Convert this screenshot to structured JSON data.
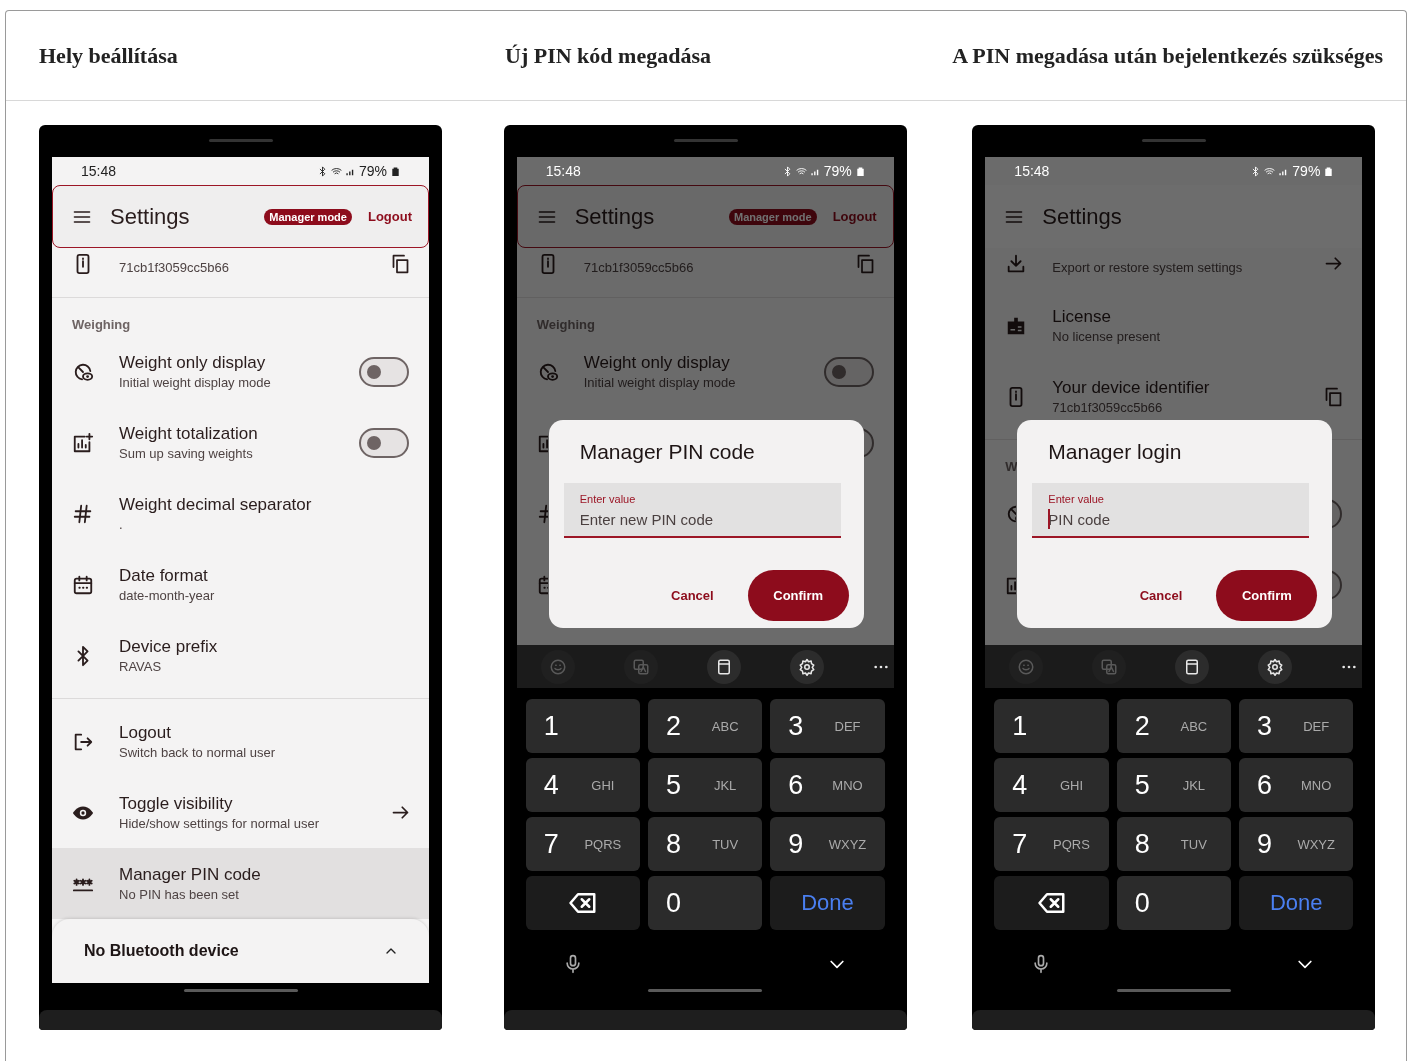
{
  "captions": [
    "Hely beállítása",
    "Új PIN kód megadása",
    "A PIN megadása után bejelentkezés szükséges"
  ],
  "phones": [
    {
      "status": {
        "time": "15:48",
        "battery": "79%"
      },
      "app_bar": {
        "title": "Settings",
        "badge": "Manager mode",
        "action": "Logout",
        "outlined": true
      },
      "list": [
        {
          "kind": "copy",
          "subtitle": "71cb1f3059cc5b66",
          "selected": false
        },
        {
          "kind": "divider"
        },
        {
          "kind": "header",
          "label": "Weighing"
        },
        {
          "kind": "toggle",
          "title": "Weight only display",
          "subtitle": "Initial weight display mode",
          "on": false,
          "selected": false
        },
        {
          "kind": "toggle",
          "title": "Weight totalization",
          "subtitle": "Sum up saving weights",
          "on": false,
          "selected": false
        },
        {
          "kind": "plain",
          "title": "Weight decimal separator",
          "subtitle": ".",
          "selected": false
        },
        {
          "kind": "plain",
          "title": "Date format",
          "subtitle": "date-month-year",
          "selected": false
        },
        {
          "kind": "plain",
          "title": "Device prefix",
          "subtitle": "RAVAS",
          "selected": false
        },
        {
          "kind": "divider"
        },
        {
          "kind": "plain",
          "title": "Logout",
          "subtitle": "Switch back to normal user",
          "selected": false
        },
        {
          "kind": "arrow",
          "title": "Toggle visibility",
          "subtitle": "Hide/show settings for normal user",
          "selected": false
        },
        {
          "kind": "plain",
          "title": "Manager PIN code",
          "subtitle": "No PIN has been set",
          "selected": true
        }
      ],
      "bottom_sheet": {
        "label": "No Bluetooth device"
      }
    },
    {
      "status": {
        "time": "15:48",
        "battery": "79%"
      },
      "app_bar": {
        "title": "Settings",
        "badge": "Manager mode",
        "action": "Logout",
        "outlined": true
      },
      "list": [
        {
          "kind": "copy",
          "subtitle": "71cb1f3059cc5b66"
        },
        {
          "kind": "divider"
        },
        {
          "kind": "header",
          "label": "Weighing"
        },
        {
          "kind": "toggle",
          "title": "Weight only display",
          "subtitle": "Initial weight display mode",
          "on": false
        },
        {
          "kind": "toggle",
          "on": false
        },
        {
          "kind": "plain"
        },
        {
          "kind": "plain"
        },
        {
          "kind": "plain"
        }
      ],
      "dialog": {
        "title": "Manager PIN code",
        "field": {
          "label": "Enter value",
          "placeholder": "Enter new PIN code",
          "cursor": false
        },
        "buttons": [
          {
            "kind": "text",
            "label": "Cancel"
          },
          {
            "kind": "filled",
            "label": "Confirm"
          }
        ]
      },
      "keyboard": {
        "toolbar": [
          {
            "disabled": true
          },
          {
            "disabled": true
          },
          {
            "disabled": false
          },
          {
            "disabled": false
          },
          {
            "disabled": false
          }
        ],
        "keys": [
          {
            "kind": "digit",
            "label": "1"
          },
          {
            "kind": "digit",
            "label": "2",
            "letters": "ABC"
          },
          {
            "kind": "digit",
            "label": "3",
            "letters": "DEF"
          },
          {
            "kind": "digit",
            "label": "4",
            "letters": "GHI"
          },
          {
            "kind": "digit",
            "label": "5",
            "letters": "JKL"
          },
          {
            "kind": "digit",
            "label": "6",
            "letters": "MNO"
          },
          {
            "kind": "digit",
            "label": "7",
            "letters": "PQRS"
          },
          {
            "kind": "digit",
            "label": "8",
            "letters": "TUV"
          },
          {
            "kind": "digit",
            "label": "9",
            "letters": "WXYZ"
          },
          {
            "kind": "backspace"
          },
          {
            "kind": "digit",
            "label": "0"
          },
          {
            "kind": "action",
            "label": "Done"
          }
        ]
      }
    },
    {
      "status": {
        "time": "15:48",
        "battery": "79%"
      },
      "app_bar": {
        "title": "Settings",
        "outlined": false
      },
      "list": [
        {
          "kind": "arrow",
          "subtitle": "Export or restore system settings"
        },
        {
          "kind": "plain",
          "title": "License",
          "subtitle": "No license present"
        },
        {
          "kind": "copy",
          "title": "Your device identifier",
          "subtitle": "71cb1f3059cc5b66"
        },
        {
          "kind": "divider"
        },
        {
          "kind": "header",
          "label": "W"
        },
        {
          "kind": "toggle",
          "on": false
        },
        {
          "kind": "toggle",
          "on": false
        },
        {
          "kind": "plain"
        }
      ],
      "dialog": {
        "title": "Manager login",
        "field": {
          "label": "Enter value",
          "placeholder": "PIN code",
          "cursor": true
        },
        "buttons": [
          {
            "kind": "text",
            "label": "Cancel"
          },
          {
            "kind": "filled",
            "label": "Confirm"
          }
        ]
      },
      "keyboard": {
        "toolbar": [
          {
            "disabled": true
          },
          {
            "disabled": true
          },
          {
            "disabled": false
          },
          {
            "disabled": false
          },
          {
            "disabled": false
          }
        ],
        "keys": [
          {
            "kind": "digit",
            "label": "1"
          },
          {
            "kind": "digit",
            "label": "2",
            "letters": "ABC"
          },
          {
            "kind": "digit",
            "label": "3",
            "letters": "DEF"
          },
          {
            "kind": "digit",
            "label": "4",
            "letters": "GHI"
          },
          {
            "kind": "digit",
            "label": "5",
            "letters": "JKL"
          },
          {
            "kind": "digit",
            "label": "6",
            "letters": "MNO"
          },
          {
            "kind": "digit",
            "label": "7",
            "letters": "PQRS"
          },
          {
            "kind": "digit",
            "label": "8",
            "letters": "TUV"
          },
          {
            "kind": "digit",
            "label": "9",
            "letters": "WXYZ"
          },
          {
            "kind": "backspace"
          },
          {
            "kind": "digit",
            "label": "0"
          },
          {
            "kind": "action",
            "label": "Done"
          }
        ]
      }
    }
  ]
}
